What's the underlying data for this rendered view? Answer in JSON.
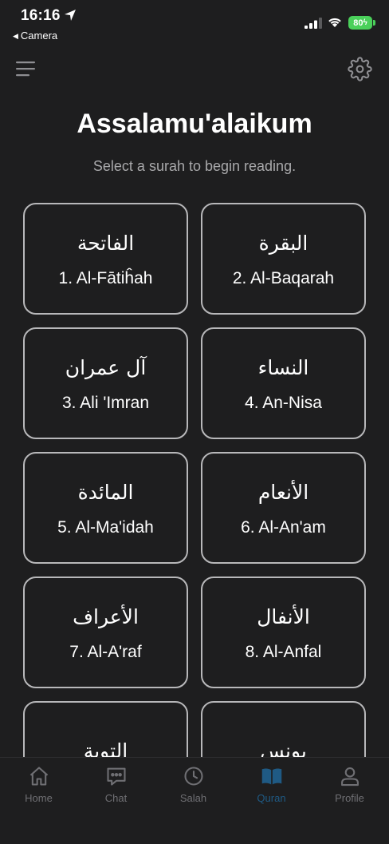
{
  "status_bar": {
    "time": "16:16",
    "back_app": "Camera",
    "battery": "80"
  },
  "header": {
    "greeting": "Assalamu'alaikum",
    "subtitle": "Select a surah to begin reading."
  },
  "surahs": [
    {
      "arabic": "الفاتحة",
      "name": "1. Al-Fātiĥah"
    },
    {
      "arabic": "البقرة",
      "name": "2. Al-Baqarah"
    },
    {
      "arabic": "آل عمران",
      "name": "3. Ali 'Imran"
    },
    {
      "arabic": "النساء",
      "name": "4. An-Nisa"
    },
    {
      "arabic": "المائدة",
      "name": "5. Al-Ma'idah"
    },
    {
      "arabic": "الأنعام",
      "name": "6. Al-An'am"
    },
    {
      "arabic": "الأعراف",
      "name": "7. Al-A'raf"
    },
    {
      "arabic": "الأنفال",
      "name": "8. Al-Anfal"
    },
    {
      "arabic": "التوبة",
      "name": ""
    },
    {
      "arabic": "يونس",
      "name": ""
    }
  ],
  "tabs": [
    {
      "label": "Home",
      "icon": "home-icon"
    },
    {
      "label": "Chat",
      "icon": "chat-icon"
    },
    {
      "label": "Salah",
      "icon": "clock-icon"
    },
    {
      "label": "Quran",
      "icon": "book-icon",
      "active": true
    },
    {
      "label": "Profile",
      "icon": "person-icon"
    }
  ],
  "colors": {
    "background": "#1e1e1f",
    "card_border": "#b8b8ba",
    "subtitle": "#a9a9ab",
    "tab_inactive": "#6f6f73",
    "tab_active": "#1f5a84",
    "battery": "#4ad05a"
  }
}
